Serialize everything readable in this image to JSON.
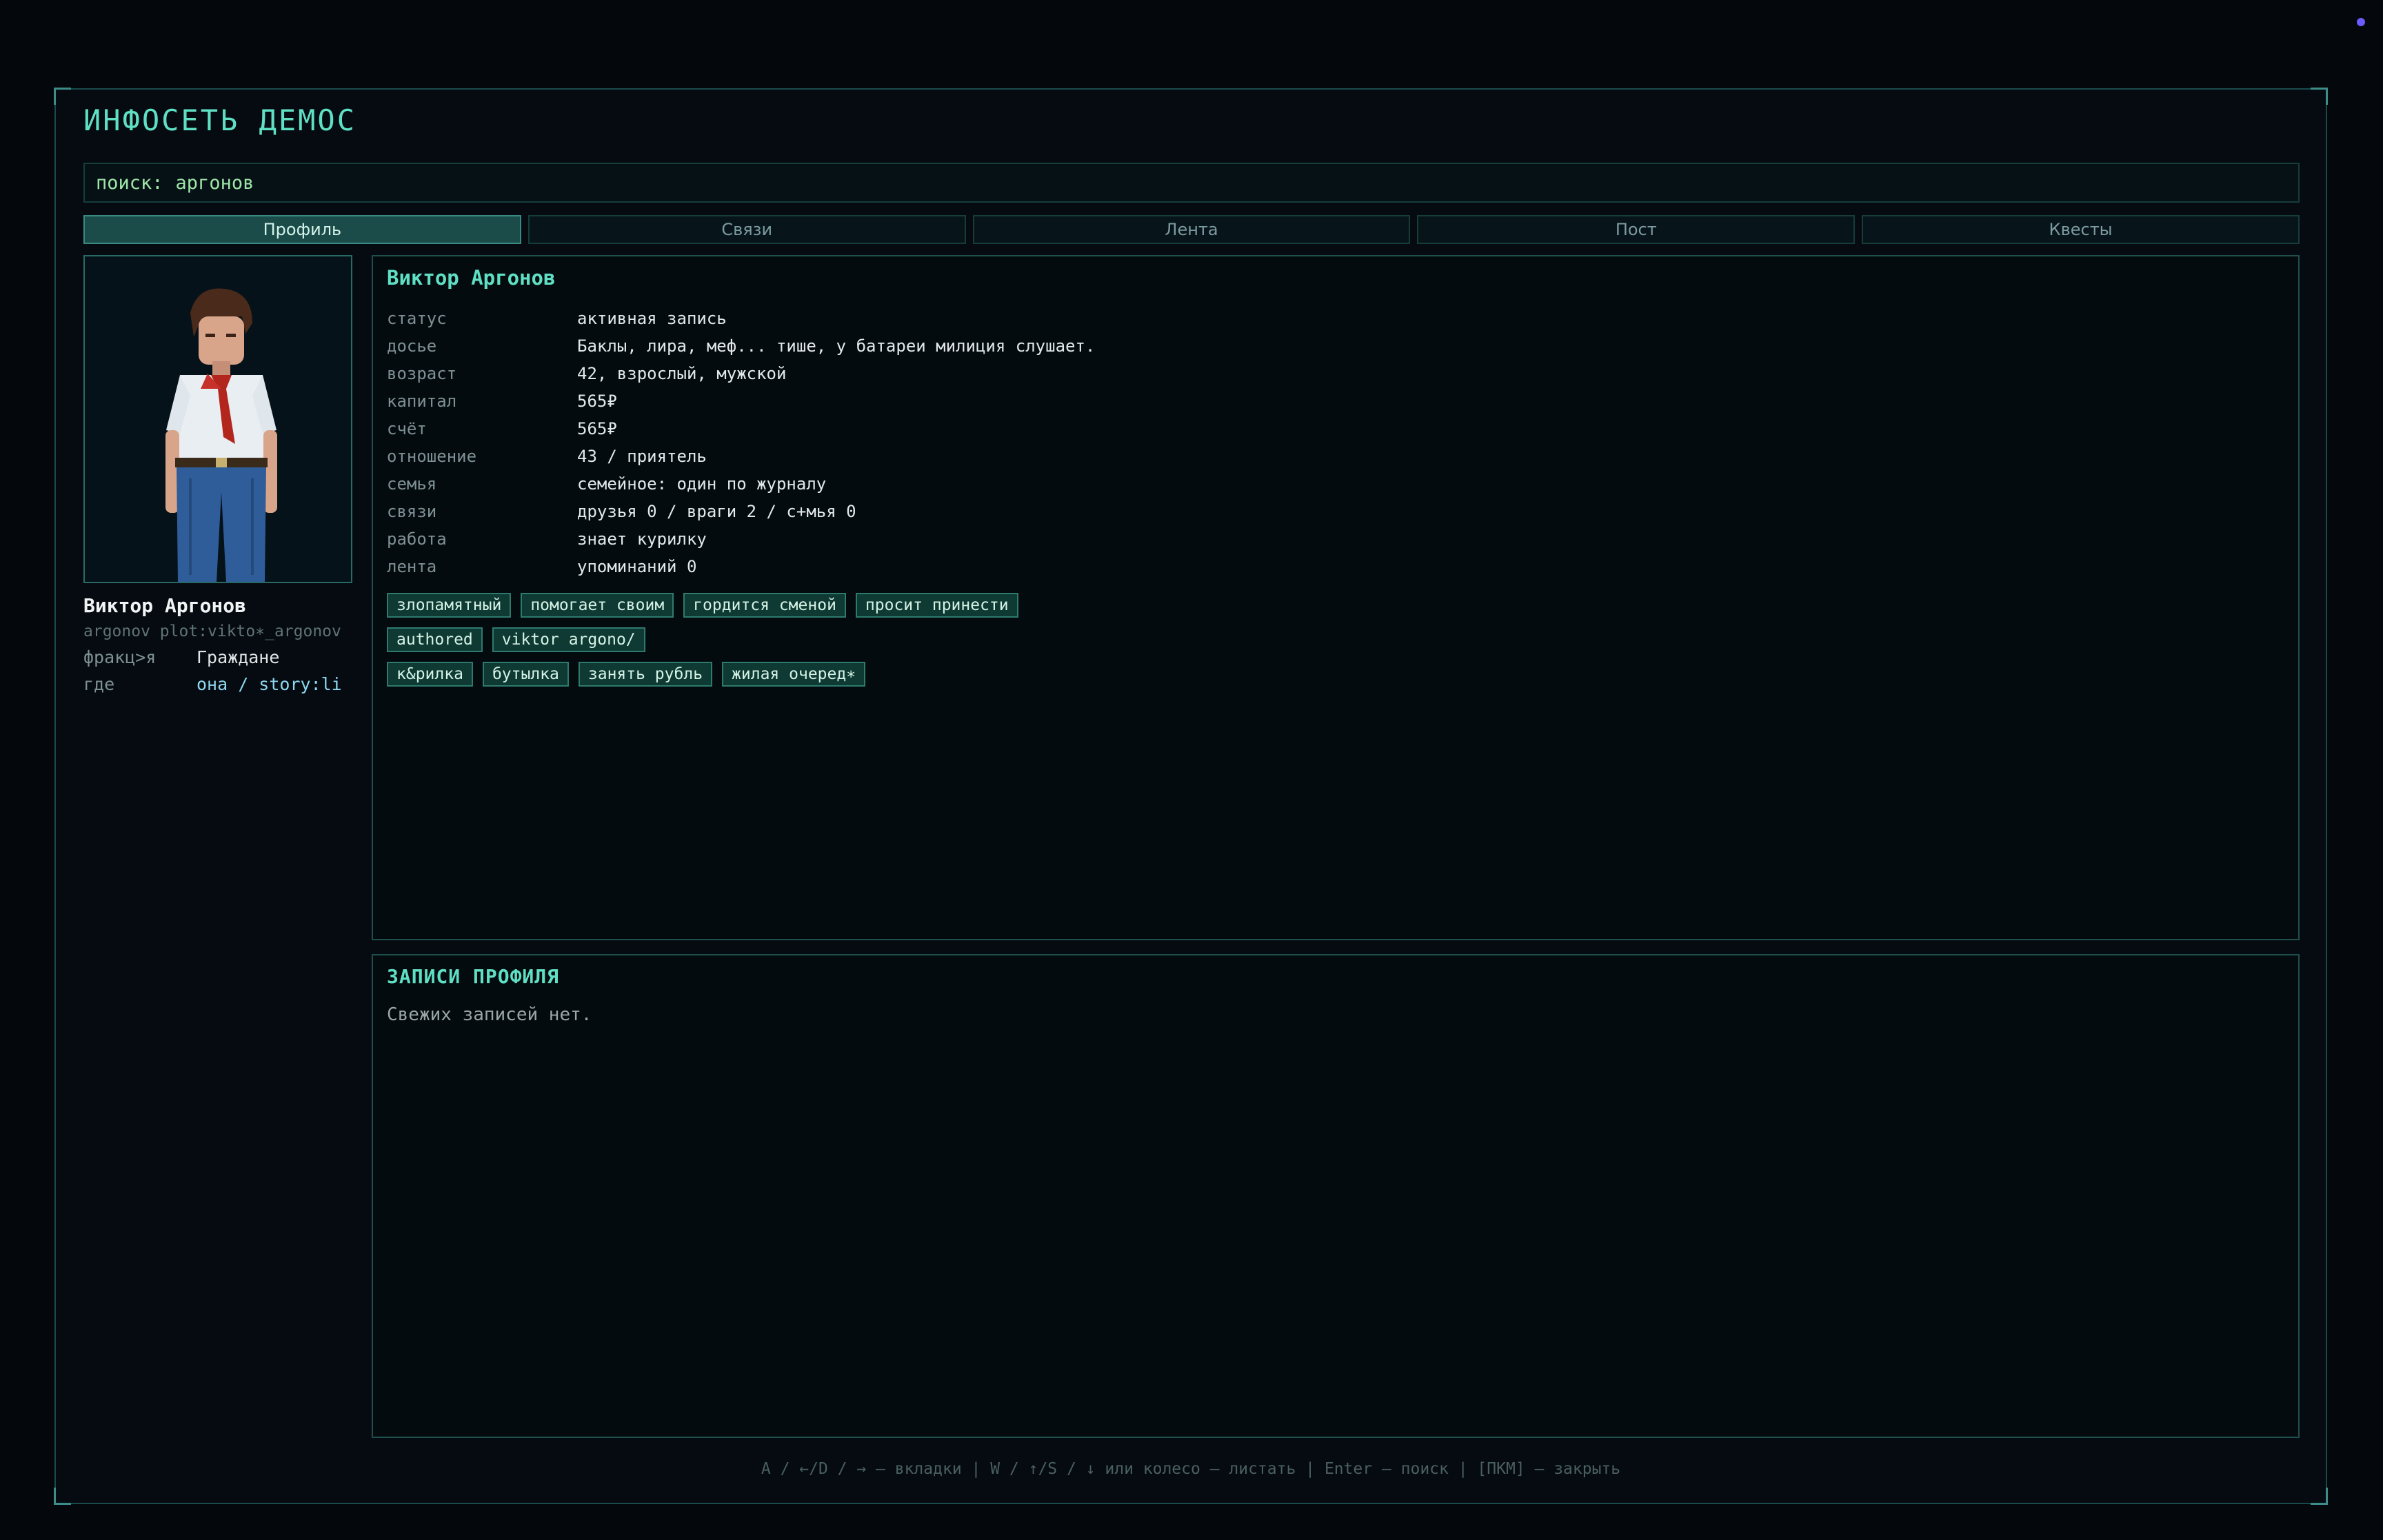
{
  "app": {
    "title": "ИНФОСЕТЬ ДЕМОС"
  },
  "search": {
    "label": "поиск:",
    "value": "аргонов"
  },
  "tabs": [
    {
      "label": "Профиль",
      "active": true
    },
    {
      "label": "Связи",
      "active": false
    },
    {
      "label": "Лента",
      "active": false
    },
    {
      "label": "Пост",
      "active": false
    },
    {
      "label": "Квесты",
      "active": false
    }
  ],
  "sidebar": {
    "name": "Виктор Аргонов",
    "id": "argonov plot:vikto∗_argonov",
    "rows": [
      {
        "key": "фракц>я",
        "value": "Граждане"
      },
      {
        "key": "где",
        "value": "она / story:li"
      }
    ]
  },
  "profile": {
    "name": "Виктор Аргонов",
    "fields": [
      {
        "key": "статус",
        "value": "активная запись"
      },
      {
        "key": "досье",
        "value": "Баклы, лира, меф... тише, у батареи милиция слушает."
      },
      {
        "key": "возраст",
        "value": "42, взрослый, мужской"
      },
      {
        "key": "капитал",
        "value": "565₽"
      },
      {
        "key": "счёт",
        "value": "565₽"
      },
      {
        "key": "отношение",
        "value": "43 / приятель"
      },
      {
        "key": "семья",
        "value": "семейное: один по журналу"
      },
      {
        "key": "связи",
        "value": "друзья 0 / враги 2 / с+мья 0"
      },
      {
        "key": "работа",
        "value": "знает курилку"
      },
      {
        "key": "лента",
        "value": "упоминаний 0"
      }
    ],
    "tag_rows": [
      [
        "злопамятный",
        "помогает своим",
        "гордится сменой",
        "просит принести"
      ],
      [
        "authored",
        "viktor argono/"
      ],
      [
        "к&рилка",
        "бутылка",
        "занять рубль",
        "жилая очеред∗"
      ]
    ]
  },
  "notes": {
    "title": "ЗАПИСИ ПРОФИЛЯ",
    "empty": "Свежих записей нет."
  },
  "footer": {
    "hint": "A / ←/D / → — вкладки  |  W / ↑/S / ↓ или колесо — листать  |  Enter — поиск  |  [ПКМ] — закрыть"
  },
  "colors": {
    "accent": "#5fe0c4",
    "tag_bg": "#0e3a33",
    "background": "#04070c"
  }
}
